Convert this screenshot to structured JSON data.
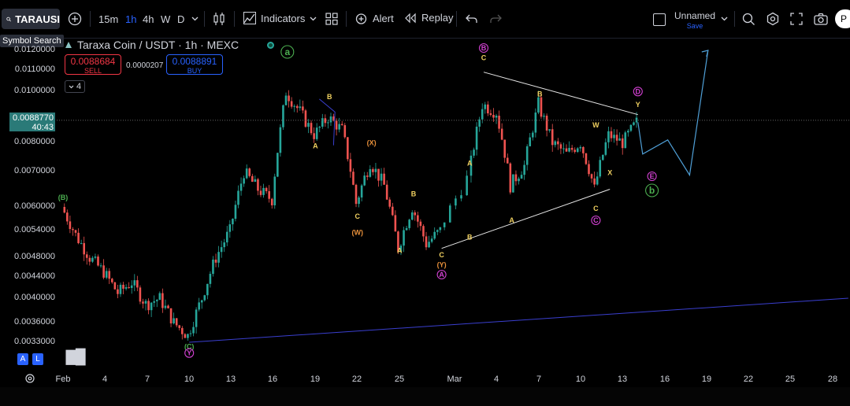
{
  "toolbar": {
    "symbol": "TARAUSI",
    "intervals": [
      "15m",
      "1h",
      "4h",
      "W",
      "D"
    ],
    "active_interval": "1h",
    "indicators_label": "Indicators",
    "alert_label": "Alert",
    "replay_label": "Replay",
    "layout_name": "Unnamed",
    "save_label": "Save",
    "avatar_letter": "P"
  },
  "tooltip": "Symbol Search",
  "header": {
    "title": "Taraxa Coin / USDT · 1h · MEXC"
  },
  "trade": {
    "sell_price": "0.0088684",
    "sell_label": "SELL",
    "spread": "0.0000207",
    "buy_price": "0.0088891",
    "buy_label": "BUY",
    "collapsed_count": "4"
  },
  "last_price": {
    "value": "0.0088770",
    "countdown": "40:43",
    "color": "#2a7a78"
  },
  "bottom_left": {
    "a_label": "A",
    "l_label": "L"
  },
  "colors": {
    "bull": "#26a69a",
    "bear": "#ef5350",
    "background": "#000000",
    "trendline": "#3a3fcf",
    "projection": "#4f9fd6",
    "wave_yellow": "#f0d060",
    "wave_orange": "#e8903a",
    "wave_magenta": "#d040d0",
    "wave_green": "#4caf50"
  },
  "chart_data": {
    "type": "candlestick",
    "title": "Taraxa Coin / USDT · 1h · MEXC",
    "y_ticks": [
      "0.0120000",
      "0.0110000",
      "0.0100000",
      "0.0090000",
      "0.0080000",
      "0.0070000",
      "0.0060000",
      "0.0054000",
      "0.0048000",
      "0.0044000",
      "0.0040000",
      "0.0036000",
      "0.0033000"
    ],
    "x_ticks": [
      "Feb",
      "4",
      "7",
      "10",
      "13",
      "16",
      "19",
      "22",
      "25",
      "Mar",
      "4",
      "7",
      "10",
      "13",
      "16",
      "19",
      "22",
      "25",
      "28"
    ],
    "price_path": [
      {
        "date": "Feb 1",
        "price": 0.006
      },
      {
        "date": "Feb 2",
        "price": 0.0053
      },
      {
        "date": "Feb 3",
        "price": 0.0048
      },
      {
        "date": "Feb 4",
        "price": 0.0045
      },
      {
        "date": "Feb 5",
        "price": 0.0041
      },
      {
        "date": "Feb 6",
        "price": 0.0043
      },
      {
        "date": "Feb 7",
        "price": 0.0039
      },
      {
        "date": "Feb 8",
        "price": 0.004
      },
      {
        "date": "Feb 9",
        "price": 0.0036
      },
      {
        "date": "Feb 10",
        "price": 0.0034
      },
      {
        "date": "Feb 11",
        "price": 0.004
      },
      {
        "date": "Feb 12",
        "price": 0.0048
      },
      {
        "date": "Feb 13",
        "price": 0.0054
      },
      {
        "date": "Feb 14",
        "price": 0.007
      },
      {
        "date": "Feb 15",
        "price": 0.0065
      },
      {
        "date": "Feb 16",
        "price": 0.0062
      },
      {
        "date": "Feb 17",
        "price": 0.01
      },
      {
        "date": "Feb 18",
        "price": 0.0092
      },
      {
        "date": "Feb 19",
        "price": 0.0083
      },
      {
        "date": "Feb 20",
        "price": 0.009
      },
      {
        "date": "Feb 21",
        "price": 0.0085
      },
      {
        "date": "Feb 22",
        "price": 0.0061
      },
      {
        "date": "Feb 23",
        "price": 0.0073
      },
      {
        "date": "Feb 24",
        "price": 0.0066
      },
      {
        "date": "Feb 25",
        "price": 0.005
      },
      {
        "date": "Feb 26",
        "price": 0.006
      },
      {
        "date": "Feb 27",
        "price": 0.0051
      },
      {
        "date": "Feb 28",
        "price": 0.0054
      },
      {
        "date": "Mar 1",
        "price": 0.0068
      },
      {
        "date": "Mar 2",
        "price": 0.0095
      },
      {
        "date": "Mar 3",
        "price": 0.0092
      },
      {
        "date": "Mar 4",
        "price": 0.0066
      },
      {
        "date": "Mar 5",
        "price": 0.0072
      },
      {
        "date": "Mar 6",
        "price": 0.0095
      },
      {
        "date": "Mar 7",
        "price": 0.008
      },
      {
        "date": "Mar 8",
        "price": 0.0076
      },
      {
        "date": "Mar 9",
        "price": 0.008
      },
      {
        "date": "Mar 10",
        "price": 0.0065
      },
      {
        "date": "Mar 11",
        "price": 0.0083
      },
      {
        "date": "Mar 12",
        "price": 0.008
      },
      {
        "date": "Mar 13",
        "price": 0.0088
      }
    ],
    "projection": [
      {
        "date": "Mar 13",
        "price": 0.0088
      },
      {
        "date": "Mar 13",
        "price": 0.0076
      },
      {
        "date": "Mar 14",
        "price": 0.0081
      },
      {
        "date": "Mar 15",
        "price": 0.0069
      },
      {
        "date": "Mar 18",
        "price": 0.012
      }
    ],
    "wave_labels": [
      {
        "text": "a",
        "date": "Feb 17",
        "price": 0.0118,
        "color": "green",
        "circled": true
      },
      {
        "text": "B",
        "date": "Feb 20",
        "price": 0.0097,
        "color": "yellow"
      },
      {
        "text": "A",
        "date": "Feb 19",
        "price": 0.0078,
        "color": "yellow"
      },
      {
        "text": "(X)",
        "date": "Feb 23",
        "price": 0.0079,
        "color": "orange"
      },
      {
        "text": "C",
        "date": "Feb 22",
        "price": 0.0057,
        "color": "yellow"
      },
      {
        "text": "(W)",
        "date": "Feb 22",
        "price": 0.0053,
        "color": "orange"
      },
      {
        "text": "B",
        "date": "Feb 26",
        "price": 0.0063,
        "color": "yellow"
      },
      {
        "text": "A",
        "date": "Feb 25",
        "price": 0.0049,
        "color": "yellow"
      },
      {
        "text": "C",
        "date": "Feb 28",
        "price": 0.0048,
        "color": "yellow"
      },
      {
        "text": "(Y)",
        "date": "Feb 28",
        "price": 0.0046,
        "color": "orange"
      },
      {
        "text": "A",
        "date": "Feb 28",
        "price": 0.0044,
        "color": "magenta",
        "circled": true
      },
      {
        "text": "A",
        "date": "Mar 1",
        "price": 0.0072,
        "color": "yellow"
      },
      {
        "text": "B",
        "date": "Mar 1",
        "price": 0.0052,
        "color": "yellow"
      },
      {
        "text": "B",
        "date": "Mar 2",
        "price": 0.012,
        "color": "magenta",
        "circled": true
      },
      {
        "text": "C",
        "date": "Mar 2",
        "price": 0.0115,
        "color": "yellow"
      },
      {
        "text": "B",
        "date": "Mar 6",
        "price": 0.0098,
        "color": "yellow"
      },
      {
        "text": "A",
        "date": "Mar 4",
        "price": 0.0056,
        "color": "yellow"
      },
      {
        "text": "W",
        "date": "Mar 10",
        "price": 0.0086,
        "color": "yellow"
      },
      {
        "text": "X",
        "date": "Mar 11",
        "price": 0.0069,
        "color": "yellow"
      },
      {
        "text": "C",
        "date": "Mar 10",
        "price": 0.0059,
        "color": "yellow"
      },
      {
        "text": "C",
        "date": "Mar 10",
        "price": 0.0056,
        "color": "magenta",
        "circled": true
      },
      {
        "text": "D",
        "date": "Mar 13",
        "price": 0.0099,
        "color": "magenta",
        "circled": true
      },
      {
        "text": "Y",
        "date": "Mar 13",
        "price": 0.0094,
        "color": "yellow"
      },
      {
        "text": "E",
        "date": "Mar 14",
        "price": 0.0068,
        "color": "magenta",
        "circled": true
      },
      {
        "text": "b",
        "date": "Mar 14",
        "price": 0.0064,
        "color": "green",
        "circled": true
      },
      {
        "text": "(B)",
        "date": "Feb 1",
        "price": 0.0062,
        "color": "green"
      },
      {
        "text": "(C)",
        "date": "Feb 10",
        "price": 0.0032,
        "color": "green"
      },
      {
        "text": "Y",
        "date": "Feb 10",
        "price": 0.0031,
        "color": "magenta",
        "circled": true
      }
    ],
    "trendlines": [
      {
        "from": {
          "date": "Feb 10",
          "price": 0.0033
        },
        "to": {
          "date": "Mar 28",
          "price": 0.004
        },
        "color": "blue"
      },
      {
        "from": {
          "date": "Mar 2",
          "price": 0.0109
        },
        "to": {
          "date": "Mar 13",
          "price": 0.0091
        },
        "color": "white"
      },
      {
        "from": {
          "date": "Feb 28",
          "price": 0.005
        },
        "to": {
          "date": "Mar 11",
          "price": 0.0065
        },
        "color": "white"
      }
    ],
    "grid": false
  }
}
